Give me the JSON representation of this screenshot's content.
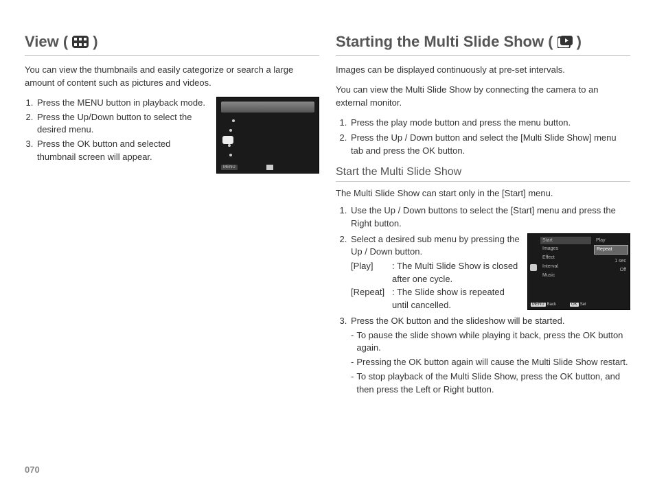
{
  "page_number": "070",
  "left": {
    "heading_pre": "View (",
    "heading_post": ")",
    "intro": "You can view the thumbnails and easily categorize or search a large amount of content such as pictures and videos.",
    "steps": [
      "Press the MENU button in playback mode.",
      "Press the Up/Down button to select the desired menu.",
      "Press the OK button and selected thumbnail screen will appear."
    ]
  },
  "right": {
    "heading_pre": "Starting the Multi Slide Show (",
    "heading_post": ")",
    "intro1": "Images can be displayed continuously at pre-set intervals.",
    "intro2": "You can view the Multi Slide Show by connecting the camera to an external monitor.",
    "steps_a": [
      "Press the play mode button and press the menu button.",
      "Press the Up / Down button and select the [Multi Slide Show] menu tab and press the OK button."
    ],
    "subheading": "Start the Multi Slide Show",
    "subnote": "The Multi Slide Show can start only in the [Start] menu.",
    "steps_b1": "Use the Up / Down buttons to select the [Start] menu and press the Right button.",
    "steps_b2": "Select a desired sub menu by pressing the Up / Down button.",
    "opt_play_label": "[Play]",
    "opt_play_desc": ": The Multi Slide Show is closed after one cycle.",
    "opt_repeat_label": "[Repeat]",
    "opt_repeat_desc": ": The Slide show is repeated until cancelled.",
    "steps_b3": "Press the OK button and the slideshow will be started.",
    "dashes": [
      "To pause the slide shown while playing it back, press the OK button again.",
      "Pressing the OK button again will cause the Multi Slide Show restart.",
      "To stop playback of the Multi Slide Show, press the OK button, and then press the Left or Right button."
    ],
    "menu": {
      "left_items": [
        "Start",
        "Images",
        "Effect",
        "Interval",
        "Music"
      ],
      "right_items": [
        "Play",
        "Repeat",
        "",
        "1 sec",
        "Off"
      ],
      "footer_back_btn": "MENU",
      "footer_back_label": "Back",
      "footer_set_btn": "OK",
      "footer_set_label": "Set"
    }
  }
}
